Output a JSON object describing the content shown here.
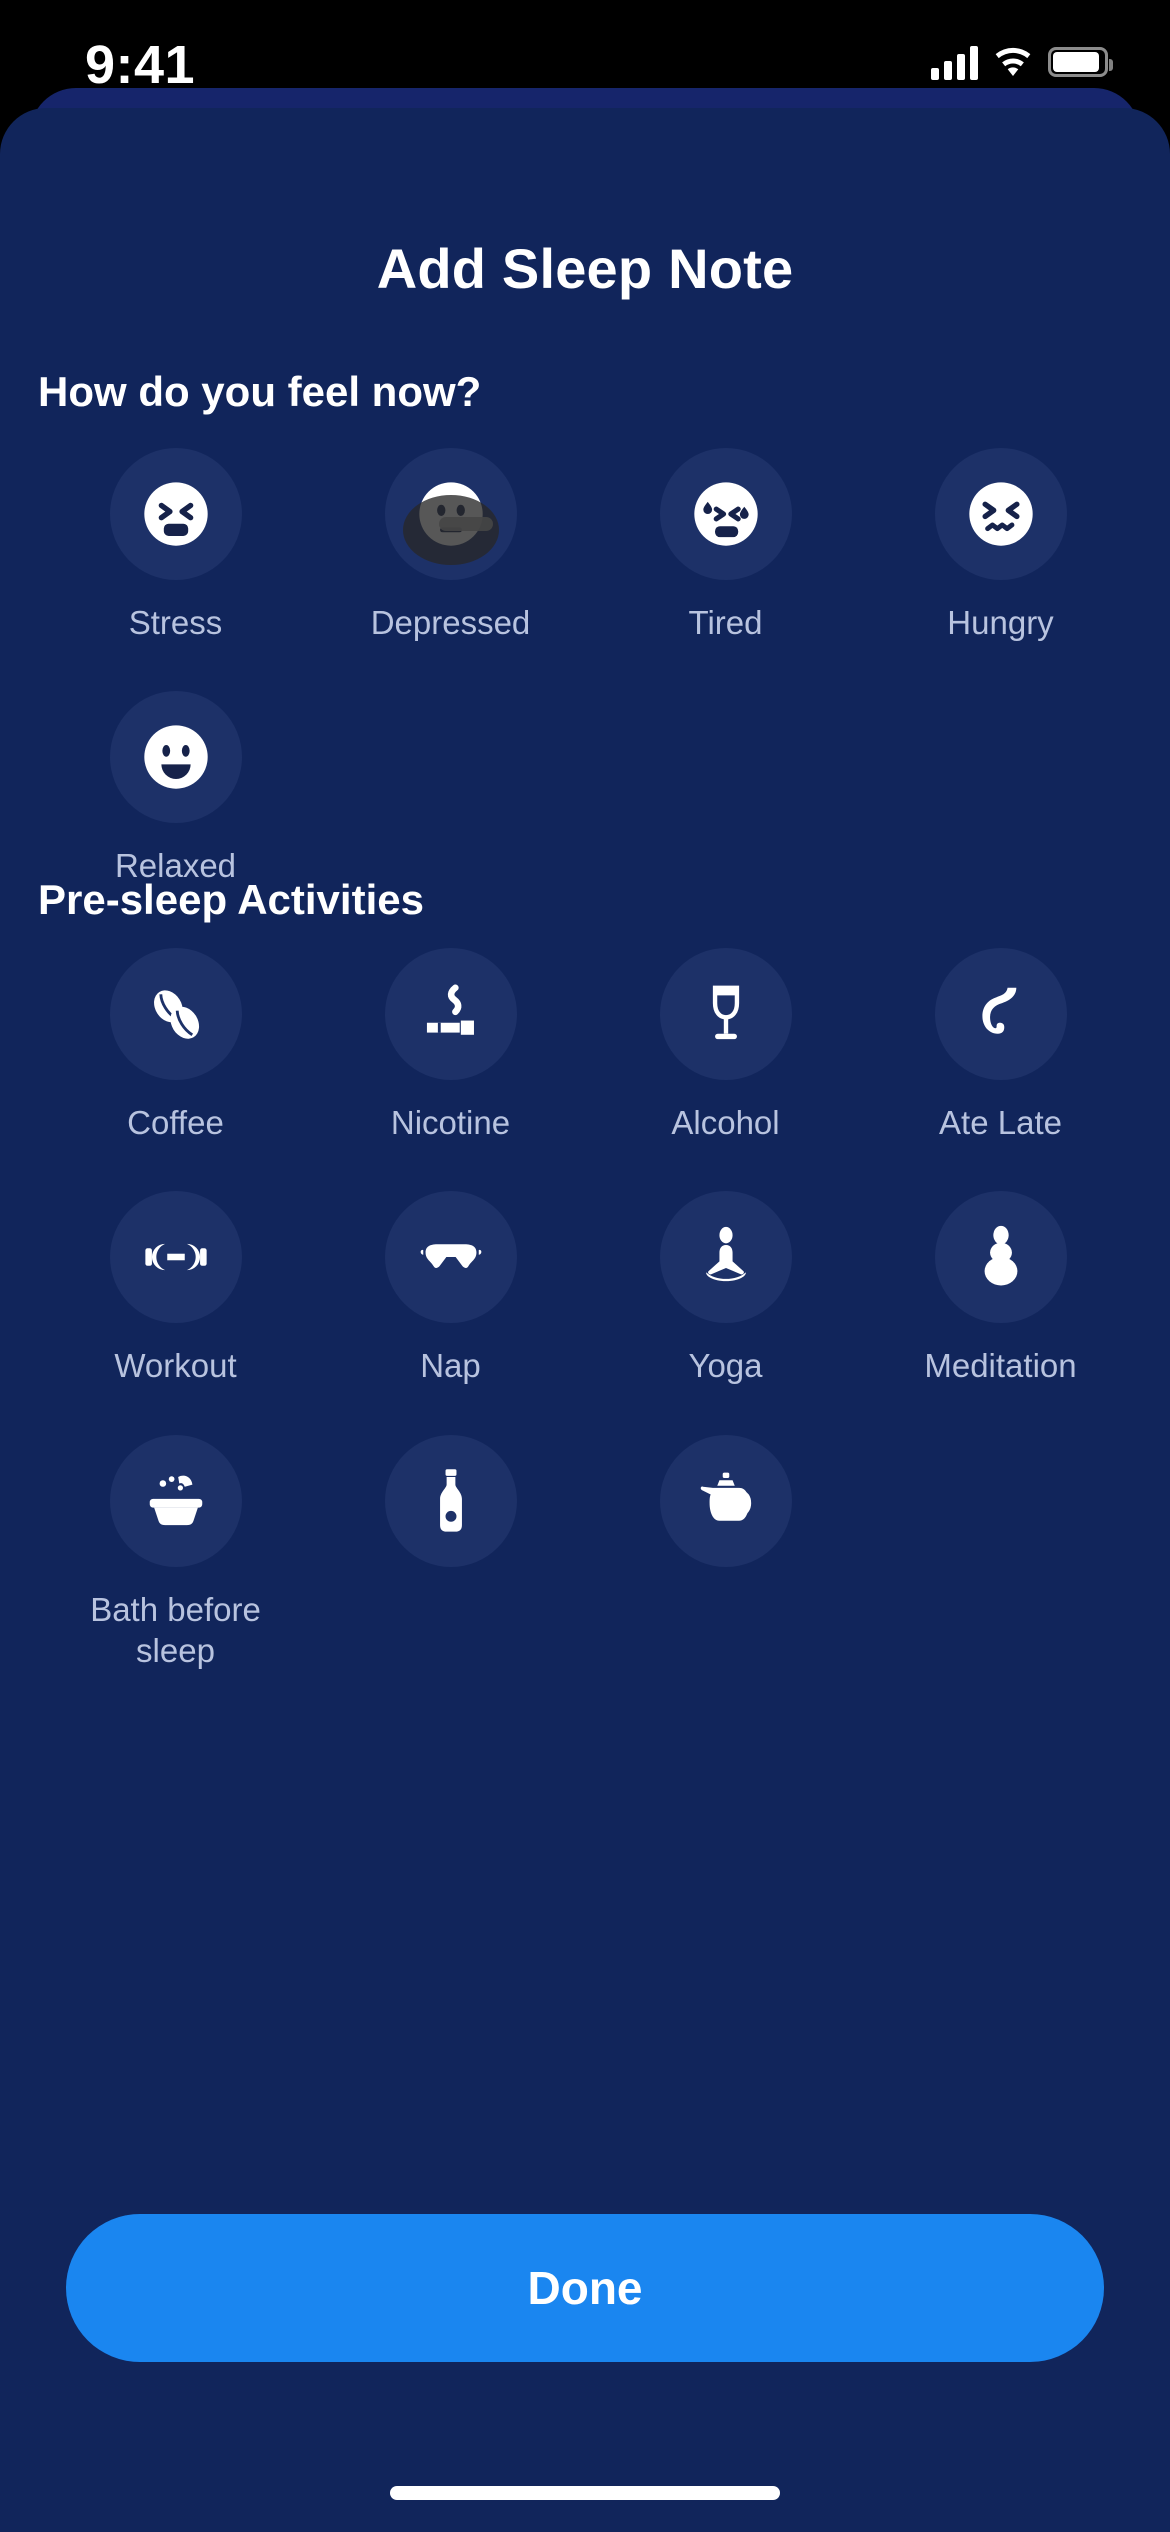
{
  "status_bar": {
    "time": "9:41",
    "cellular_icon": "signal-bars-icon",
    "wifi_icon": "wifi-icon",
    "battery_icon": "battery-icon"
  },
  "sheet": {
    "title": "Add Sleep Note"
  },
  "mood_section": {
    "heading": "How do you feel now?",
    "items": [
      {
        "label": "Stress",
        "icon": "face-stressed-icon",
        "selected": false,
        "tapped": false
      },
      {
        "label": "Depressed",
        "icon": "face-depressed-icon",
        "selected": false,
        "tapped": true
      },
      {
        "label": "Tired",
        "icon": "face-tired-icon",
        "selected": false,
        "tapped": false
      },
      {
        "label": "Hungry",
        "icon": "face-hungry-icon",
        "selected": false,
        "tapped": false
      },
      {
        "label": "Relaxed",
        "icon": "face-relaxed-icon",
        "selected": false,
        "tapped": false
      }
    ]
  },
  "activities_section": {
    "heading": "Pre-sleep Activities",
    "items": [
      {
        "label": "Coffee",
        "icon": "coffee-beans-icon"
      },
      {
        "label": "Nicotine",
        "icon": "cigarette-icon"
      },
      {
        "label": "Alcohol",
        "icon": "wine-glass-icon"
      },
      {
        "label": "Ate Late",
        "icon": "stomach-icon"
      },
      {
        "label": "Workout",
        "icon": "dumbbell-icon"
      },
      {
        "label": "Nap",
        "icon": "sleep-mask-icon"
      },
      {
        "label": "Yoga",
        "icon": "lotus-pose-icon"
      },
      {
        "label": "Meditation",
        "icon": "meditation-figure-icon"
      },
      {
        "label": "Bath before sleep",
        "icon": "bathtub-icon"
      },
      {
        "label": "",
        "icon": "bottle-icon"
      },
      {
        "label": "",
        "icon": "teapot-icon"
      }
    ]
  },
  "footer": {
    "done_label": "Done"
  },
  "colors": {
    "sheet_background": "#11255b",
    "chip_background": "#1d3168",
    "accent_button": "#1a86f0",
    "caption_text": "#b8c3df",
    "heading_text": "#ffffff"
  }
}
